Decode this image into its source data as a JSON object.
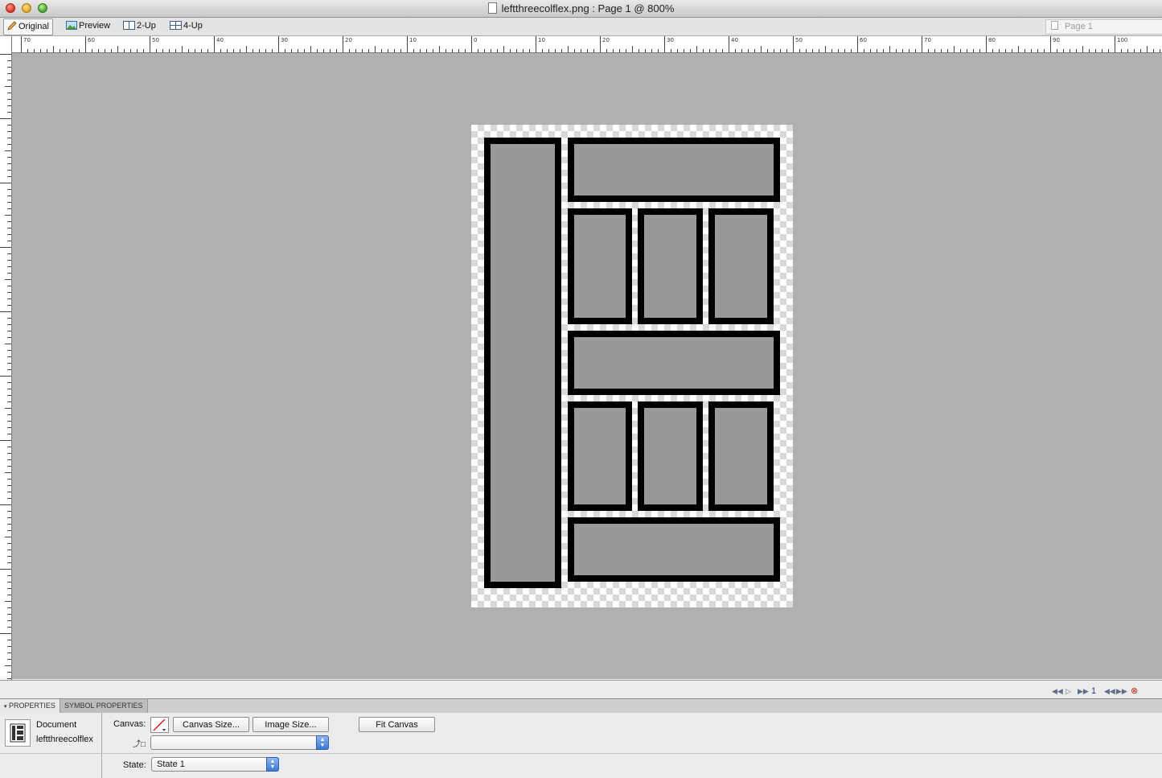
{
  "window": {
    "title": "leftthreecolflex.png : Page 1 @ 800%"
  },
  "view_tabs": [
    {
      "label": "Original",
      "icon": "pencil-icon",
      "active": true
    },
    {
      "label": "Preview",
      "icon": "image-icon",
      "active": false
    },
    {
      "label": "2-Up",
      "icon": "two-up-icon",
      "active": false
    },
    {
      "label": "4-Up",
      "icon": "four-up-icon",
      "active": false
    }
  ],
  "page_selector": {
    "label": "Page 1"
  },
  "ruler": {
    "labels": [
      "70",
      "60",
      "50",
      "40",
      "30",
      "20",
      "10",
      "0",
      "10",
      "20",
      "30",
      "40",
      "50",
      "60",
      "70",
      "80",
      "90",
      "100"
    ]
  },
  "status": {
    "frame_number": "1"
  },
  "panel": {
    "tabs": [
      {
        "label": "PROPERTIES",
        "active": true
      },
      {
        "label": "SYMBOL PROPERTIES",
        "active": false
      }
    ],
    "document_label": "Document",
    "document_name": "leftthreecolflex",
    "canvas_label": "Canvas:",
    "canvas_size_button": "Canvas Size...",
    "image_size_button": "Image Size...",
    "fit_canvas_button": "Fit Canvas",
    "state_label": "State:",
    "state_value": "State 1"
  },
  "colors": {
    "canvas_background": "#b0b0b0",
    "block_fill": "#999999",
    "block_stroke": "#000000",
    "select_accent": "#3b78d8"
  }
}
